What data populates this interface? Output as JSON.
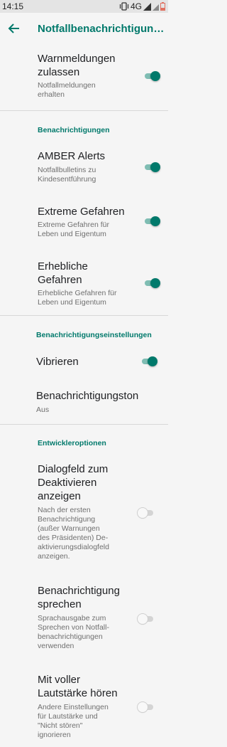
{
  "status_bar": {
    "time": "14:15",
    "network": "4G"
  },
  "app_bar": {
    "title": "Notfallbenachrichtigungen"
  },
  "items": {
    "allow_alerts": {
      "title": "Warnmeldungen zulassen",
      "summary": "Notfallmeldungen erhalten",
      "enabled": true
    },
    "amber": {
      "title": "AMBER Alerts",
      "summary": "Notfallbulletins zu Kindesentführung",
      "enabled": true
    },
    "extreme": {
      "title": "Extreme Gefahren",
      "summary": "Extreme Gefahren für Leben und Eigentum",
      "enabled": true
    },
    "severe": {
      "title": "Erhebliche Gefahren",
      "summary": "Erhebliche Gefahren für Leben und Eigentum",
      "enabled": true
    },
    "vibrate": {
      "title": "Vibrieren",
      "enabled": true
    },
    "tone": {
      "title": "Benachrichtigungston",
      "summary": "Aus"
    },
    "opt_out_dialog": {
      "title": "Dialogfeld zum Deaktivieren anzeigen",
      "summary": "Nach der ersten Benachrichtigung (außer Warnungen des Präsidenten) De-aktivierungsdialogfeld anzeigen.",
      "enabled": false
    },
    "speak": {
      "title": "Benachrichtigung sprechen",
      "summary": "Sprachausgabe zum Sprechen von Notfall-benachrichtigungen verwenden",
      "enabled": false
    },
    "full_volume": {
      "title": "Mit voller Lautstärke hören",
      "summary": "Andere Einstellungen für Lautstärke und \"Nicht stören\" ignorieren",
      "enabled": false
    }
  },
  "sections": {
    "notifications": "Benachrichtigungen",
    "notification_settings": "Benachrichtigungseinstellungen",
    "developer_options": "Entwickleroptionen"
  },
  "colors": {
    "accent": "#00796b",
    "background": "#f5f5f5",
    "status_bar": "#e4e4e4"
  },
  "icons": {
    "back": "arrow-back-icon",
    "vibrate": "vibrate-icon",
    "signal": "signal-icon",
    "battery": "battery-icon"
  }
}
